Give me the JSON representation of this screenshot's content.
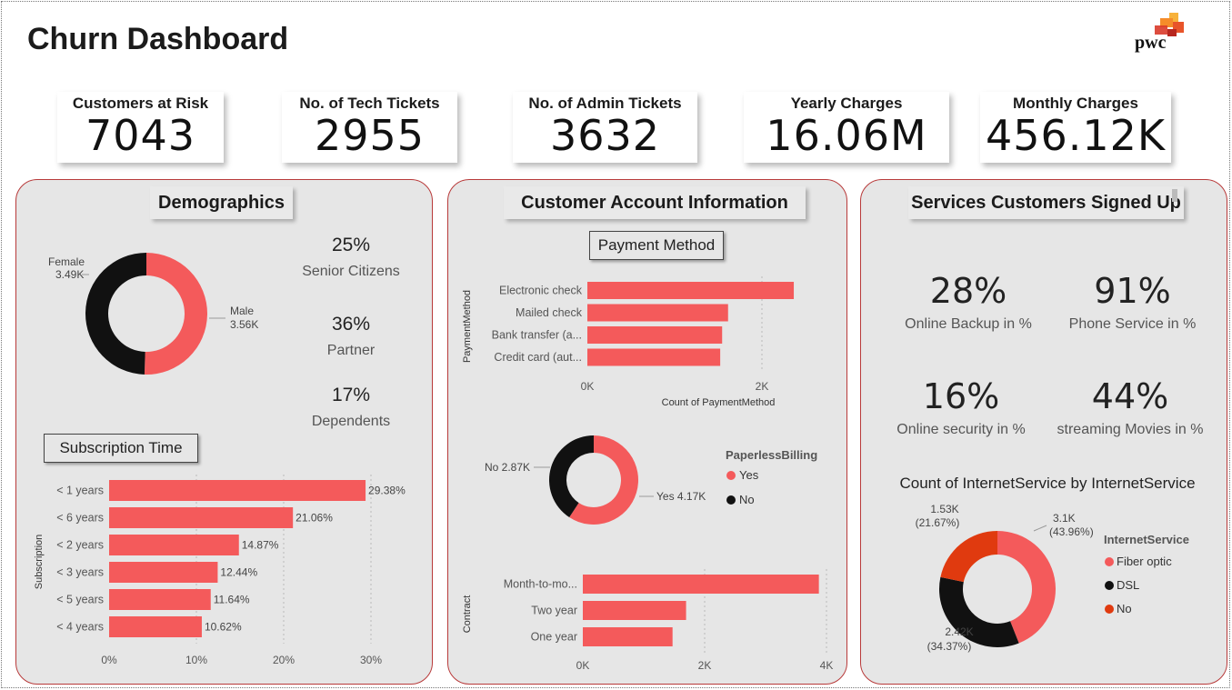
{
  "title": "Churn Dashboard",
  "logo_text": "pwc",
  "colors": {
    "coral": "#f45a5b",
    "black": "#111111",
    "orange_red": "#e03a0f",
    "panel_bg": "#e6e6e6",
    "panel_border": "#b83a3a"
  },
  "kpis": [
    {
      "label": "Customers at Risk",
      "value": "7043"
    },
    {
      "label": "No. of Tech Tickets",
      "value": "2955"
    },
    {
      "label": "No. of Admin Tickets",
      "value": "3632"
    },
    {
      "label": "Yearly Charges",
      "value": "16.06M"
    },
    {
      "label": "Monthly Charges",
      "value": "456.12K"
    }
  ],
  "demographics": {
    "header": "Demographics",
    "gender_donut": {
      "slices": [
        {
          "label": "Female",
          "value_label": "3.49K",
          "value": 3.49,
          "color": "#111111"
        },
        {
          "label": "Male",
          "value_label": "3.56K",
          "value": 3.56,
          "color": "#f45a5b"
        }
      ]
    },
    "stats": [
      {
        "value": "25%",
        "label": "Senior Citizens"
      },
      {
        "value": "36%",
        "label": "Partner"
      },
      {
        "value": "17%",
        "label": "Dependents"
      }
    ],
    "subscription_label": "Subscription Time"
  },
  "account": {
    "header": "Customer Account Information",
    "payment_label": "Payment Method",
    "paperless": {
      "legend_title": "PaperlessBilling",
      "items": [
        {
          "label": "Yes",
          "value_label": "Yes 4.17K",
          "value": 4.17,
          "color": "#f45a5b"
        },
        {
          "label": "No",
          "value_label": "No 2.87K",
          "value": 2.87,
          "color": "#111111"
        }
      ]
    }
  },
  "services": {
    "header": "Services Customers Signed Up",
    "stats": [
      {
        "value": "28%",
        "label": "Online Backup in %"
      },
      {
        "value": "91%",
        "label": "Phone Service in %"
      },
      {
        "value": "16%",
        "label": "Online security in %"
      },
      {
        "value": "44%",
        "label": "streaming Movies in %"
      }
    ],
    "internet": {
      "title": "Count of InternetService by InternetService",
      "legend_title": "InternetService",
      "slices": [
        {
          "label": "Fiber optic",
          "value": 3.1,
          "value_label": "3.1K",
          "pct_label": "(43.96%)",
          "color": "#f45a5b"
        },
        {
          "label": "DSL",
          "value": 2.42,
          "value_label": "2.42K",
          "pct_label": "(34.37%)",
          "color": "#111111"
        },
        {
          "label": "No",
          "value": 1.53,
          "value_label": "1.53K",
          "pct_label": "(21.67%)",
          "color": "#e03a0f"
        }
      ]
    }
  },
  "chart_data": [
    {
      "type": "bar",
      "title": "Subscription Time",
      "orientation": "horizontal",
      "ylabel": "Subscription",
      "categories": [
        "< 1 years",
        "< 6 years",
        "< 2 years",
        "< 3 years",
        "< 5 years",
        "< 4 years"
      ],
      "values": [
        29.38,
        21.06,
        14.87,
        12.44,
        11.64,
        10.62
      ],
      "data_labels": [
        "29.38%",
        "21.06%",
        "14.87%",
        "12.44%",
        "11.64%",
        "10.62%"
      ],
      "xticks": [
        "0%",
        "10%",
        "20%",
        "30%"
      ],
      "xlim": [
        0,
        30
      ]
    },
    {
      "type": "bar",
      "title": "Payment Method",
      "orientation": "horizontal",
      "ylabel": "PaymentMethod",
      "xlabel": "Count of PaymentMethod",
      "categories": [
        "Electronic check",
        "Mailed check",
        "Bank transfer (a...",
        "Credit card (aut..."
      ],
      "values": [
        2365,
        1612,
        1544,
        1522
      ],
      "xticks": [
        "0K",
        "2K"
      ],
      "xlim": [
        0,
        2000
      ]
    },
    {
      "type": "bar",
      "orientation": "horizontal",
      "ylabel": "Contract",
      "categories": [
        "Month-to-mo...",
        "Two year",
        "One year"
      ],
      "values": [
        3875,
        1695,
        1473
      ],
      "xticks": [
        "0K",
        "2K",
        "4K"
      ],
      "xlim": [
        0,
        4000
      ]
    }
  ]
}
